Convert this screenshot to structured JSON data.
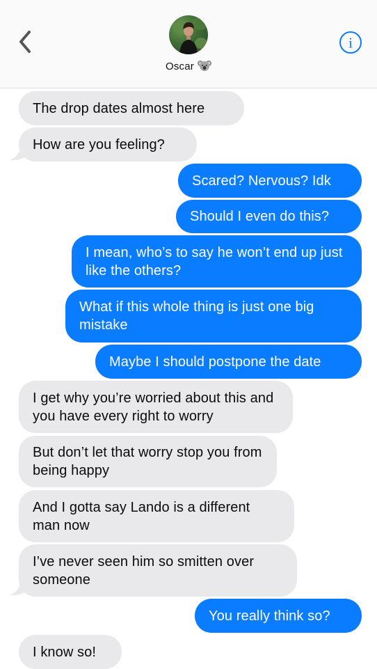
{
  "header": {
    "back_icon": "chevron-left-icon",
    "contact_name": "Oscar",
    "contact_emoji": "koala-emoji",
    "info_icon": "info-circle-icon",
    "accent_color": "#0a7cff"
  },
  "messages": [
    {
      "direction": "incoming",
      "text": "The drop dates almost here"
    },
    {
      "direction": "incoming",
      "text": "How are you feeling?"
    },
    {
      "direction": "outgoing",
      "text": "Scared? Nervous? Idk"
    },
    {
      "direction": "outgoing",
      "text": "Should I even do this?"
    },
    {
      "direction": "outgoing",
      "text": "I mean, who’s to say he won’t end up just like the others?"
    },
    {
      "direction": "outgoing",
      "text": "What if this whole thing is just one big mistake"
    },
    {
      "direction": "outgoing",
      "text": "Maybe I should postpone the date"
    },
    {
      "direction": "incoming",
      "text": "I get why you’re worried about this and you have every right to worry"
    },
    {
      "direction": "incoming",
      "text": "But don’t let that worry stop you from being happy"
    },
    {
      "direction": "incoming",
      "text": "And I gotta say Lando is a different man now"
    },
    {
      "direction": "incoming",
      "text": "I’ve never seen him so smitten over someone"
    },
    {
      "direction": "outgoing",
      "text": "You really think so?"
    },
    {
      "direction": "incoming",
      "text": "I know so!"
    }
  ]
}
